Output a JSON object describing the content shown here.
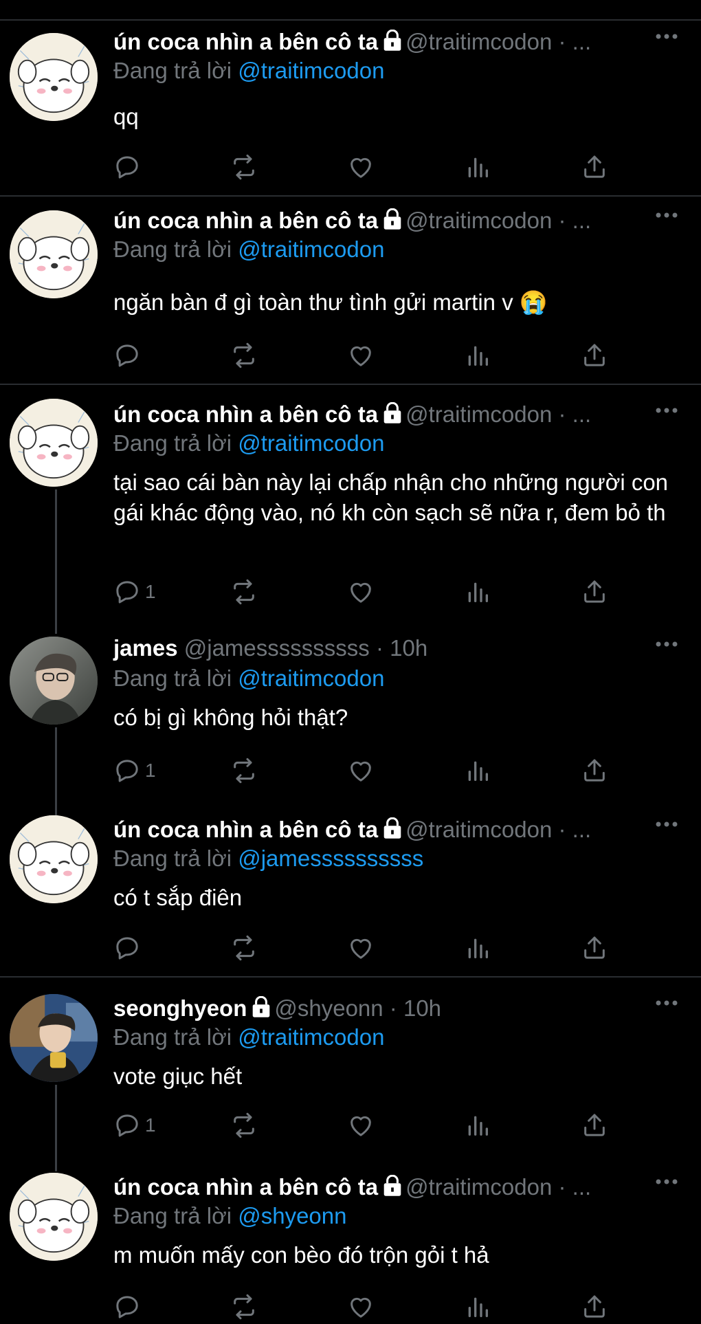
{
  "tweets": [
    {
      "name": "ún coca nhìn a bên cô ta",
      "locked": true,
      "handle": "@traitimcodon",
      "time": "...",
      "reply_label": "Đang trả lời",
      "reply_to": "@traitimcodon",
      "text": "qq",
      "reply_count": ""
    },
    {
      "name": "ún coca nhìn a bên cô ta",
      "locked": true,
      "handle": "@traitimcodon",
      "time": "...",
      "reply_label": "Đang trả lời",
      "reply_to": "@traitimcodon",
      "text": "ngăn bàn đ gì toàn thư tình gửi martin v 😭",
      "reply_count": ""
    },
    {
      "name": "ún coca nhìn a bên cô ta",
      "locked": true,
      "handle": "@traitimcodon",
      "time": "...",
      "reply_label": "Đang trả lời",
      "reply_to": "@traitimcodon",
      "text": "tại sao cái bàn này lại chấp nhận cho những người con gái khác động vào, nó kh còn sạch sẽ nữa r, đem bỏ th",
      "reply_count": "1"
    },
    {
      "name": "james",
      "locked": false,
      "handle": "@jamessssssssss",
      "time": "10h",
      "reply_label": "Đang trả lời",
      "reply_to": "@traitimcodon",
      "text": "có bị gì không hỏi thật?",
      "reply_count": "1"
    },
    {
      "name": "ún coca nhìn a bên cô ta",
      "locked": true,
      "handle": "@traitimcodon",
      "time": "...",
      "reply_label": "Đang trả lời",
      "reply_to": "@jamessssssssss",
      "text": "có t sắp điên",
      "reply_count": ""
    },
    {
      "name": "seonghyeon",
      "locked": true,
      "handle": "@shyeonn",
      "time": "10h",
      "reply_label": "Đang trả lời",
      "reply_to": "@traitimcodon",
      "text": "vote giục hết",
      "reply_count": "1"
    },
    {
      "name": "ún coca nhìn a bên cô ta",
      "locked": true,
      "handle": "@traitimcodon",
      "time": "...",
      "reply_label": "Đang trả lời",
      "reply_to": "@shyeonn",
      "text": "m muốn mấy con bèo đó trộn gỏi t hả",
      "reply_count": ""
    }
  ],
  "dot": "·",
  "colors": {
    "background": "#000000",
    "mention": "#1d9bf0",
    "muted": "#71767b",
    "divider": "#2a2d31"
  },
  "icons": [
    "reply-icon",
    "retweet-icon",
    "like-icon",
    "views-icon",
    "share-icon",
    "more-icon",
    "lock-icon"
  ]
}
